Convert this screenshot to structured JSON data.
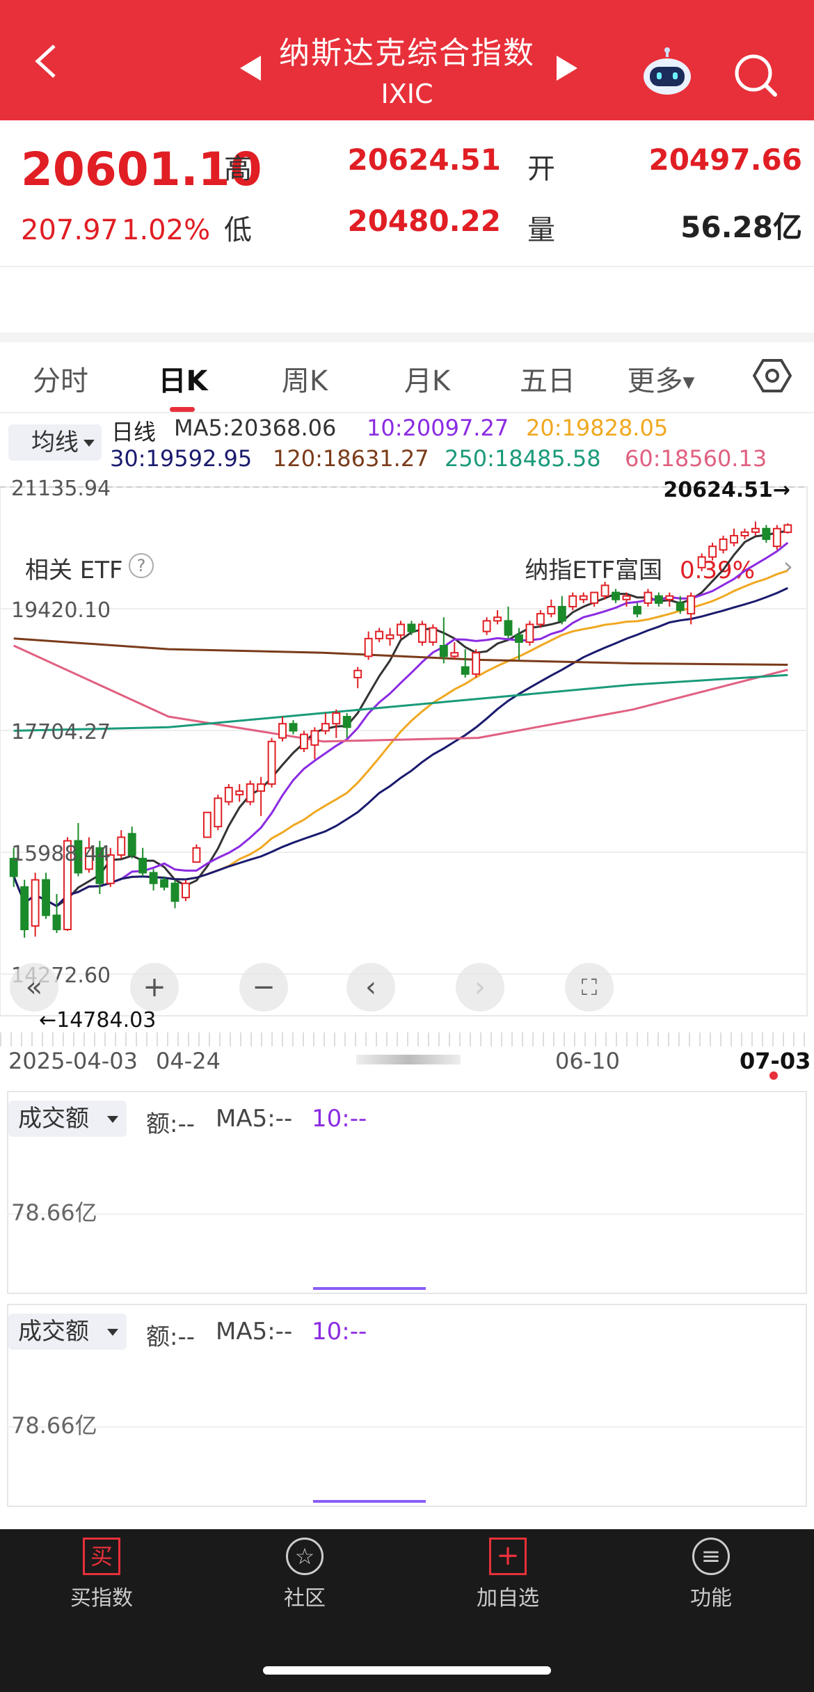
{
  "header": {
    "title": "纳斯达克综合指数",
    "code": "IXIC"
  },
  "quote": {
    "price": "20601.10",
    "change": "207.97",
    "change_pct": "1.02%",
    "high_label": "高",
    "high": "20624.51",
    "low_label": "低",
    "low": "20480.22",
    "open_label": "开",
    "open": "20497.66",
    "volume_label": "量",
    "volume": "56.28亿"
  },
  "etf": {
    "label": "相关 ETF",
    "help": "?",
    "name": "纳指ETF富国",
    "pct": "0.39%"
  },
  "tabs": [
    "分时",
    "日K",
    "周K",
    "月K",
    "五日",
    "更多"
  ],
  "ma_legend": {
    "button": "均线",
    "prefix": "日线",
    "ma5": "MA5:20368.06",
    "ma10": "10:20097.27",
    "ma20": "20:19828.05",
    "ma30": "30:19592.95",
    "ma120": "120:18631.27",
    "ma250": "250:18485.58",
    "ma60": "60:18560.13"
  },
  "chart_data": {
    "type": "candlestick",
    "y_ticks": [
      "21135.94",
      "19420.10",
      "17704.27",
      "15988.44",
      "14272.60"
    ],
    "ylim": [
      14272.6,
      21135.94
    ],
    "x_labels": [
      "2025-04-03",
      "04-24",
      "06-10",
      "07-03"
    ],
    "high_marker": "20624.51→",
    "low_marker": "←14784.03",
    "series_colors": {
      "ma5": "#333333",
      "ma10": "#8b2be2",
      "ma20": "#f0a820",
      "ma30": "#1a1a6e",
      "ma60": "#e06080",
      "ma120": "#7a3b1a",
      "ma250": "#1a9a7a",
      "up": "#e01e24",
      "down": "#1a8a2a"
    },
    "candles": [
      {
        "o": 15900,
        "h": 16050,
        "c": 15650,
        "l": 15500
      },
      {
        "o": 15500,
        "h": 15600,
        "c": 14900,
        "l": 14784
      },
      {
        "o": 14950,
        "h": 15700,
        "c": 15600,
        "l": 14800
      },
      {
        "o": 15600,
        "h": 15700,
        "c": 15100,
        "l": 15050
      },
      {
        "o": 15100,
        "h": 15400,
        "c": 14900,
        "l": 14850
      },
      {
        "o": 14900,
        "h": 16200,
        "c": 16150,
        "l": 14880
      },
      {
        "o": 16150,
        "h": 16400,
        "c": 15700,
        "l": 15650
      },
      {
        "o": 15750,
        "h": 16200,
        "c": 16050,
        "l": 15700
      },
      {
        "o": 16050,
        "h": 16150,
        "c": 15550,
        "l": 15400
      },
      {
        "o": 15550,
        "h": 16050,
        "c": 15950,
        "l": 15500
      },
      {
        "o": 15950,
        "h": 16300,
        "c": 16200,
        "l": 15900
      },
      {
        "o": 16250,
        "h": 16350,
        "c": 15950,
        "l": 15900
      },
      {
        "o": 15900,
        "h": 16050,
        "c": 15700,
        "l": 15650
      },
      {
        "o": 15700,
        "h": 15750,
        "c": 15550,
        "l": 15450
      },
      {
        "o": 15600,
        "h": 15650,
        "c": 15500,
        "l": 15450
      },
      {
        "o": 15550,
        "h": 15600,
        "c": 15300,
        "l": 15200
      },
      {
        "o": 15350,
        "h": 15600,
        "c": 15550,
        "l": 15300
      },
      {
        "o": 15850,
        "h": 16100,
        "c": 16050,
        "l": 15850
      },
      {
        "o": 16200,
        "h": 16400,
        "c": 16550,
        "l": 16300
      },
      {
        "o": 16350,
        "h": 16800,
        "c": 16750,
        "l": 16300
      },
      {
        "o": 16700,
        "h": 16950,
        "c": 16900,
        "l": 16650
      },
      {
        "o": 16800,
        "h": 16950,
        "c": 16850,
        "l": 16700
      },
      {
        "o": 16700,
        "h": 17000,
        "c": 16950,
        "l": 16650
      },
      {
        "o": 16850,
        "h": 17050,
        "c": 16950,
        "l": 16500
      },
      {
        "o": 16950,
        "h": 17600,
        "c": 17550,
        "l": 16900
      },
      {
        "o": 17600,
        "h": 17900,
        "c": 17800,
        "l": 17550
      },
      {
        "o": 17800,
        "h": 17850,
        "c": 17700,
        "l": 17650
      },
      {
        "o": 17450,
        "h": 17700,
        "c": 17650,
        "l": 17400
      },
      {
        "o": 17500,
        "h": 17750,
        "c": 17700,
        "l": 17300
      },
      {
        "o": 17700,
        "h": 17950,
        "c": 17800,
        "l": 17650
      },
      {
        "o": 17800,
        "h": 18000,
        "c": 17950,
        "l": 17600
      },
      {
        "o": 17900,
        "h": 17950,
        "c": 17750,
        "l": 17600
      },
      {
        "o": 18450,
        "h": 18600,
        "c": 18550,
        "l": 18300
      },
      {
        "o": 18750,
        "h": 19100,
        "c": 19000,
        "l": 18700
      },
      {
        "o": 19000,
        "h": 19150,
        "c": 19100,
        "l": 18950
      },
      {
        "o": 19000,
        "h": 19150,
        "c": 19050,
        "l": 18900
      },
      {
        "o": 19050,
        "h": 19250,
        "c": 19200,
        "l": 19000
      },
      {
        "o": 19200,
        "h": 19250,
        "c": 19100,
        "l": 19050
      },
      {
        "o": 18950,
        "h": 19250,
        "c": 19200,
        "l": 18900
      },
      {
        "o": 18950,
        "h": 19200,
        "c": 19150,
        "l": 18900
      },
      {
        "o": 18900,
        "h": 19300,
        "c": 18750,
        "l": 18650
      },
      {
        "o": 18750,
        "h": 18950,
        "c": 18800,
        "l": 18700
      },
      {
        "o": 18600,
        "h": 18850,
        "c": 18500,
        "l": 18450
      },
      {
        "o": 18500,
        "h": 18850,
        "c": 18800,
        "l": 18450
      },
      {
        "o": 19100,
        "h": 19300,
        "c": 19250,
        "l": 19050
      },
      {
        "o": 19250,
        "h": 19400,
        "c": 19300,
        "l": 19200
      },
      {
        "o": 19250,
        "h": 19450,
        "c": 19050,
        "l": 19000
      },
      {
        "o": 19050,
        "h": 19150,
        "c": 18950,
        "l": 18700
      },
      {
        "o": 18950,
        "h": 19250,
        "c": 19200,
        "l": 18900
      },
      {
        "o": 19200,
        "h": 19400,
        "c": 19350,
        "l": 19150
      },
      {
        "o": 19350,
        "h": 19550,
        "c": 19450,
        "l": 19300
      },
      {
        "o": 19450,
        "h": 19600,
        "c": 19250,
        "l": 19200
      },
      {
        "o": 19450,
        "h": 19650,
        "c": 19600,
        "l": 19400
      },
      {
        "o": 19550,
        "h": 19650,
        "c": 19600,
        "l": 19500
      },
      {
        "o": 19500,
        "h": 19650,
        "c": 19650,
        "l": 19450
      },
      {
        "o": 19600,
        "h": 19800,
        "c": 19750,
        "l": 19550
      },
      {
        "o": 19650,
        "h": 19700,
        "c": 19550,
        "l": 19500
      },
      {
        "o": 19550,
        "h": 19650,
        "c": 19600,
        "l": 19450
      },
      {
        "o": 19450,
        "h": 19500,
        "c": 19350,
        "l": 19300
      },
      {
        "o": 19500,
        "h": 19700,
        "c": 19650,
        "l": 19450
      },
      {
        "o": 19600,
        "h": 19650,
        "c": 19500,
        "l": 19450
      },
      {
        "o": 19550,
        "h": 19650,
        "c": 19600,
        "l": 19450
      },
      {
        "o": 19500,
        "h": 19600,
        "c": 19400,
        "l": 19350
      },
      {
        "o": 19350,
        "h": 19650,
        "c": 19600,
        "l": 19200
      },
      {
        "o": 20000,
        "h": 20200,
        "c": 20150,
        "l": 19950
      },
      {
        "o": 20150,
        "h": 20350,
        "c": 20300,
        "l": 20100
      },
      {
        "o": 20250,
        "h": 20450,
        "c": 20400,
        "l": 20200
      },
      {
        "o": 20350,
        "h": 20550,
        "c": 20450,
        "l": 20300
      },
      {
        "o": 20450,
        "h": 20550,
        "c": 20500,
        "l": 20400
      },
      {
        "o": 20500,
        "h": 20650,
        "c": 20550,
        "l": 20450
      },
      {
        "o": 20550,
        "h": 20600,
        "c": 20400,
        "l": 20350
      },
      {
        "o": 20300,
        "h": 20600,
        "c": 20550,
        "l": 20250
      },
      {
        "o": 20497.66,
        "h": 20624.51,
        "c": 20601.1,
        "l": 20480.22
      }
    ]
  },
  "volume_panels": [
    {
      "label": "成交额",
      "amount": "额:--",
      "ma5": "MA5:--",
      "ma10": "10:--",
      "scale": "78.66亿"
    },
    {
      "label": "成交额",
      "amount": "额:--",
      "ma5": "MA5:--",
      "ma10": "10:--",
      "scale": "78.66亿"
    }
  ],
  "bottom_nav": [
    {
      "label": "买指数",
      "icon": "buy-icon",
      "glyph": "买"
    },
    {
      "label": "社区",
      "icon": "community-icon",
      "glyph": "☆"
    },
    {
      "label": "加自选",
      "icon": "add-favorite-icon",
      "glyph": "+"
    },
    {
      "label": "功能",
      "icon": "menu-icon",
      "glyph": "≡"
    }
  ]
}
